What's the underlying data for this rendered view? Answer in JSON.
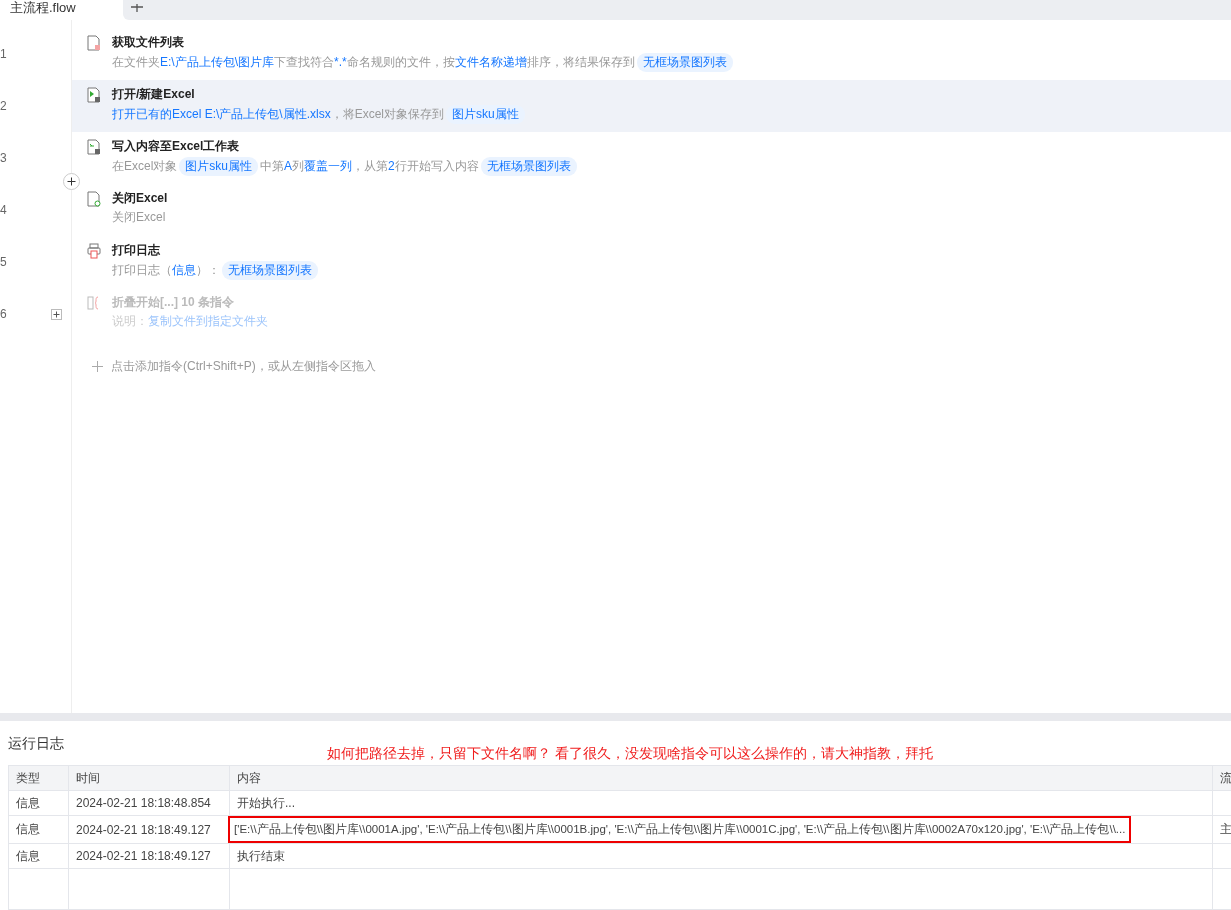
{
  "tabs": [
    {
      "label": "主流程.flow",
      "selected": true
    }
  ],
  "steps": [
    {
      "number": "1",
      "kind": "file-list",
      "selected": false,
      "disabled": false,
      "title": "获取文件列表",
      "desc": [
        {
          "kind": "text",
          "text": "在文件夹"
        },
        {
          "kind": "link",
          "text": "E:\\产品上传包\\图片库"
        },
        {
          "kind": "text",
          "text": "下查找符合"
        },
        {
          "kind": "link",
          "text": "*.*"
        },
        {
          "kind": "text",
          "text": "命名规则的文件，按"
        },
        {
          "kind": "link",
          "text": "文件名称递增"
        },
        {
          "kind": "text",
          "text": "排序，将结果保存到"
        },
        {
          "kind": "tag",
          "text": "无框场景图列表"
        }
      ]
    },
    {
      "number": "2",
      "kind": "excel-open",
      "selected": true,
      "disabled": false,
      "title": "打开/新建Excel",
      "desc": [
        {
          "kind": "link",
          "text": "打开已有的Excel E:\\产品上传包\\属性.xlsx"
        },
        {
          "kind": "text",
          "text": "，将Excel对象保存到"
        },
        {
          "kind": "tag",
          "text": "图片sku属性"
        }
      ]
    },
    {
      "number": "3",
      "kind": "excel-write",
      "selected": false,
      "disabled": false,
      "title": "写入内容至Excel工作表",
      "desc": [
        {
          "kind": "text",
          "text": "在Excel对象"
        },
        {
          "kind": "tag",
          "text": "图片sku属性"
        },
        {
          "kind": "text",
          "text": "中第"
        },
        {
          "kind": "link",
          "text": "A"
        },
        {
          "kind": "text",
          "text": "列"
        },
        {
          "kind": "link",
          "text": "覆盖一列"
        },
        {
          "kind": "text",
          "text": "，从第"
        },
        {
          "kind": "link",
          "text": "2"
        },
        {
          "kind": "text",
          "text": "行开始写入内容"
        },
        {
          "kind": "tag",
          "text": "无框场景图列表"
        }
      ]
    },
    {
      "number": "4",
      "kind": "excel-close",
      "selected": false,
      "disabled": false,
      "title": "关闭Excel",
      "desc": [
        {
          "kind": "text",
          "text": "关闭Excel"
        }
      ]
    },
    {
      "number": "5",
      "kind": "print",
      "selected": false,
      "disabled": false,
      "title": "打印日志",
      "desc": [
        {
          "kind": "text",
          "text": "打印日志（"
        },
        {
          "kind": "link",
          "text": "信息"
        },
        {
          "kind": "text",
          "text": "）："
        },
        {
          "kind": "tag",
          "text": "无框场景图列表"
        }
      ]
    },
    {
      "number": "6",
      "kind": "fold",
      "selected": false,
      "disabled": true,
      "expanded": false,
      "title": "折叠开始[...] 10 条指令",
      "desc": [
        {
          "kind": "text",
          "text": "说明："
        },
        {
          "kind": "link",
          "text": "复制文件到指定文件夹"
        }
      ]
    }
  ],
  "add_hint": "点击添加指令(Ctrl+Shift+P)，或从左侧指令区拖入",
  "log": {
    "title": "运行日志",
    "annotation": "如何把路径去掉，只留下文件名啊？ 看了很久，没发现啥指令可以这么操作的，请大神指教，拜托",
    "columns": [
      "类型",
      "时间",
      "内容",
      "流"
    ],
    "rows": [
      {
        "cells": [
          "信息",
          "2024-02-21 18:18:48.854",
          "开始执行...",
          ""
        ],
        "highlighted": false
      },
      {
        "cells": [
          "信息",
          "2024-02-21 18:18:49.127",
          "['E:\\\\产品上传包\\\\图片库\\\\0001A.jpg', 'E:\\\\产品上传包\\\\图片库\\\\0001B.jpg', 'E:\\\\产品上传包\\\\图片库\\\\0001C.jpg', 'E:\\\\产品上传包\\\\图片库\\\\0002A70x120.jpg', 'E:\\\\产品上传包\\\\...",
          "主"
        ],
        "highlighted": true
      },
      {
        "cells": [
          "信息",
          "2024-02-21 18:18:49.127",
          "执行结束",
          ""
        ],
        "highlighted": false
      }
    ]
  }
}
